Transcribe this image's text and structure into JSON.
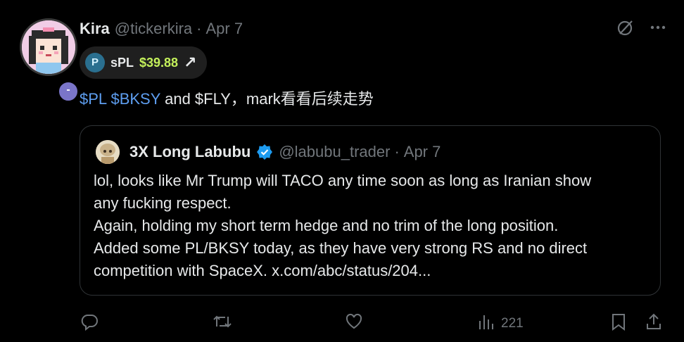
{
  "author": {
    "name": "Kira",
    "handle": "@tickerkira",
    "separator": "·",
    "date": "Apr 7",
    "avatar_badge": "-"
  },
  "ticker_pill": {
    "symbol": "sPL",
    "price": "$39.88",
    "arrow": "↗"
  },
  "tweet": {
    "cashtag1": "$PL",
    "cashtag2": "$BKSY",
    "text_after": " and $FLY，mark看看后续走势"
  },
  "quote": {
    "name": "3X Long Labubu",
    "handle": "@labubu_trader",
    "separator": "·",
    "date": "Apr 7",
    "text": "lol, looks like Mr Trump will TACO any time soon as long as Iranian show\nany fucking respect.\nAgain, holding my short term hedge and no trim of the long position.\nAdded some PL/BKSY today, as they have very strong RS and no direct\ncompetition with SpaceX. x.com/abc/status/204..."
  },
  "actions": {
    "views_count": "221"
  },
  "colors": {
    "background": "#000000",
    "text": "#e7e9ea",
    "muted": "#71767b",
    "link": "#5e9ef0",
    "price_green": "#c4f05b",
    "verified_blue": "#1d9bf0"
  },
  "icons": {
    "top": [
      "grok-icon",
      "more-icon"
    ],
    "actions": [
      "reply-icon",
      "retweet-icon",
      "like-icon",
      "views-icon",
      "bookmark-icon",
      "share-icon"
    ]
  }
}
